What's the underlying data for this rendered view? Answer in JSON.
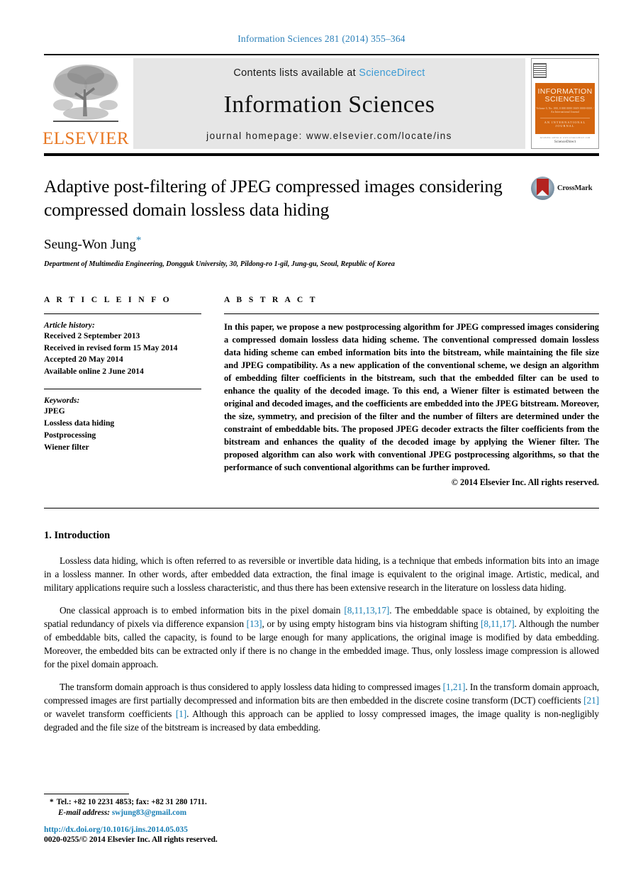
{
  "running_head": "Information Sciences 281 (2014) 355–364",
  "masthead": {
    "contents_prefix": "Contents lists available at ",
    "sciencedirect": "ScienceDirect",
    "journal_name": "Information Sciences",
    "homepage": "journal homepage: www.elsevier.com/locate/ins",
    "publisher_wordmark": "ELSEVIER",
    "cover": {
      "title_line1": "INFORMATION",
      "title_line2": "SCIENCES",
      "subtitle": "Volume 0, No. 000, 0 000 0000   ISSN 0000-0000 / An International Journal",
      "footer_band": "AN INTERNATIONAL JOURNAL",
      "bottom_caption": "Available online at www.sciencedirect.com",
      "bottom_brand": "ScienceDirect"
    },
    "accent_color": "#E87722",
    "link_color": "#3d9bd4",
    "band_color": "#d4650f"
  },
  "article": {
    "title": "Adaptive post-filtering of JPEG compressed images considering compressed domain lossless data hiding",
    "crossmark_label": "CrossMark",
    "author": "Seung-Won Jung",
    "author_footnote_marker": "*",
    "affiliation": "Department of Multimedia Engineering, Dongguk University, 30, Pildong-ro 1-gil, Jung-gu, Seoul, Republic of Korea"
  },
  "info": {
    "heading": "A R T I C L E    I N F O",
    "history_title": "Article history:",
    "history": [
      "Received 2 September 2013",
      "Received in revised form 15 May 2014",
      "Accepted 20 May 2014",
      "Available online 2 June 2014"
    ],
    "keywords_title": "Keywords:",
    "keywords": [
      "JPEG",
      "Lossless data hiding",
      "Postprocessing",
      "Wiener filter"
    ]
  },
  "abstract": {
    "heading": "A B S T R A C T",
    "text": "In this paper, we propose a new postprocessing algorithm for JPEG compressed images considering a compressed domain lossless data hiding scheme. The conventional compressed domain lossless data hiding scheme can embed information bits into the bitstream, while maintaining the file size and JPEG compatibility. As a new application of the conventional scheme, we design an algorithm of embedding filter coefficients in the bitstream, such that the embedded filter can be used to enhance the quality of the decoded image. To this end, a Wiener filter is estimated between the original and decoded images, and the coefficients are embedded into the JPEG bitstream. Moreover, the size, symmetry, and precision of the filter and the number of filters are determined under the constraint of embeddable bits. The proposed JPEG decoder extracts the filter coefficients from the bitstream and enhances the quality of the decoded image by applying the Wiener filter. The proposed algorithm can also work with conventional JPEG postprocessing algorithms, so that the performance of such conventional algorithms can be further improved.",
    "copyright": "© 2014 Elsevier Inc. All rights reserved."
  },
  "body": {
    "section_title": "1. Introduction",
    "paragraphs": [
      {
        "segments": [
          {
            "t": "Lossless data hiding, which is often referred to as reversible or invertible data hiding, is a technique that embeds information bits into an image in a lossless manner. In other words, after embedded data extraction, the final image is equivalent to the original image. Artistic, medical, and military applications require such a lossless characteristic, and thus there has been extensive research in the literature on lossless data hiding.",
            "cite": false
          }
        ]
      },
      {
        "segments": [
          {
            "t": "One classical approach is to embed information bits in the pixel domain ",
            "cite": false
          },
          {
            "t": "[8,11,13,17]",
            "cite": true
          },
          {
            "t": ". The embeddable space is obtained, by exploiting the spatial redundancy of pixels via difference expansion ",
            "cite": false
          },
          {
            "t": "[13]",
            "cite": true
          },
          {
            "t": ", or by using empty histogram bins via histogram shifting ",
            "cite": false
          },
          {
            "t": "[8,11,17]",
            "cite": true
          },
          {
            "t": ". Although the number of embeddable bits, called the capacity, is found to be large enough for many applications, the original image is modified by data embedding. Moreover, the embedded bits can be extracted only if there is no change in the embedded image. Thus, only lossless image compression is allowed for the pixel domain approach.",
            "cite": false
          }
        ]
      },
      {
        "segments": [
          {
            "t": "The transform domain approach is thus considered to apply lossless data hiding to compressed images ",
            "cite": false
          },
          {
            "t": "[1,21]",
            "cite": true
          },
          {
            "t": ". In the transform domain approach, compressed images are first partially decompressed and information bits are then embedded in the discrete cosine transform (DCT) coefficients ",
            "cite": false
          },
          {
            "t": "[21]",
            "cite": true
          },
          {
            "t": " or wavelet transform coefficients ",
            "cite": false
          },
          {
            "t": "[1]",
            "cite": true
          },
          {
            "t": ". Although this approach can be applied to lossy compressed images, the image quality is non-negligibly degraded and the file size of the bitstream is increased by data embedding.",
            "cite": false
          }
        ]
      }
    ]
  },
  "footer": {
    "tel_marker": "*",
    "tel_line": "Tel.: +82 10 2231 4853; fax: +82 31 280 1711.",
    "email_label": "E-mail address:",
    "email": "swjung83@gmail.com",
    "doi": "http://dx.doi.org/10.1016/j.ins.2014.05.035",
    "issn": "0020-0255/© 2014 Elsevier Inc. All rights reserved.",
    "link_color": "#1a7fb5"
  }
}
